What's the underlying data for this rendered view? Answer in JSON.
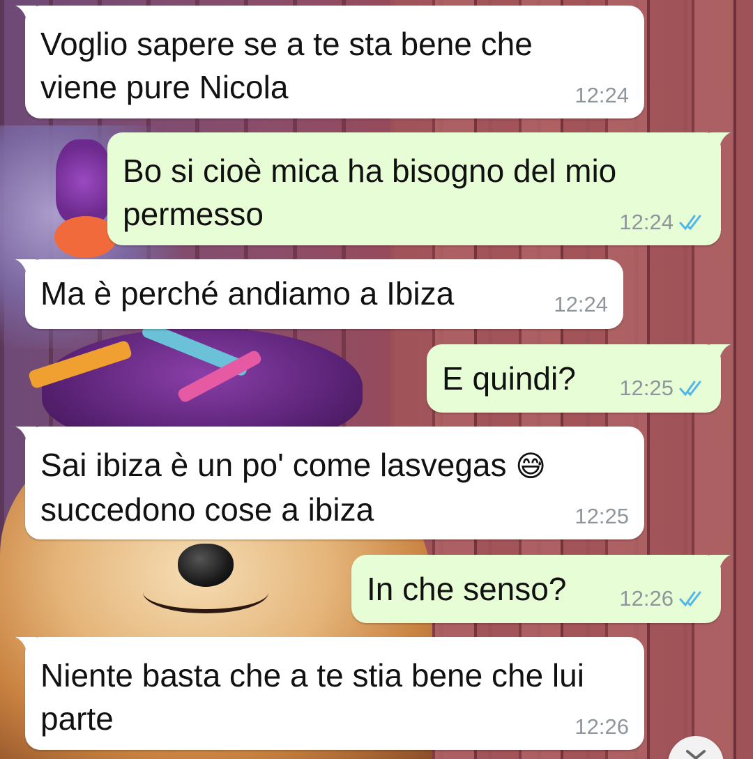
{
  "theme": {
    "incoming_bubble": "#ffffff",
    "outgoing_bubble": "#e7fdd5",
    "read_tick_color": "#4fb6ec",
    "timestamp_color": "#8f969b"
  },
  "messages": [
    {
      "direction": "incoming",
      "text": "Voglio sapere se a te sta bene che viene pure Nicola",
      "time": "12:24"
    },
    {
      "direction": "outgoing",
      "text": "Bo si cioè mica ha bisogno del mio permesso",
      "time": "12:24",
      "status": "read-double-tick-icon"
    },
    {
      "direction": "incoming",
      "text": "Ma è perché andiamo a Ibiza",
      "time": "12:24"
    },
    {
      "direction": "outgoing",
      "text": "E quindi?",
      "time": "12:25",
      "status": "read-double-tick-icon"
    },
    {
      "direction": "incoming",
      "text": "Sai ibiza è un po' come lasvegas",
      "text_line2": "succedono cose a ibiza",
      "emoji": "😅",
      "time": "12:25"
    },
    {
      "direction": "outgoing",
      "text": "In che senso?",
      "time": "12:26",
      "status": "read-double-tick-icon"
    },
    {
      "direction": "incoming",
      "text": "Niente basta che a te stia bene che lui parte",
      "time": "12:26"
    }
  ],
  "scroll_button_icon": "chevron-down-icon"
}
